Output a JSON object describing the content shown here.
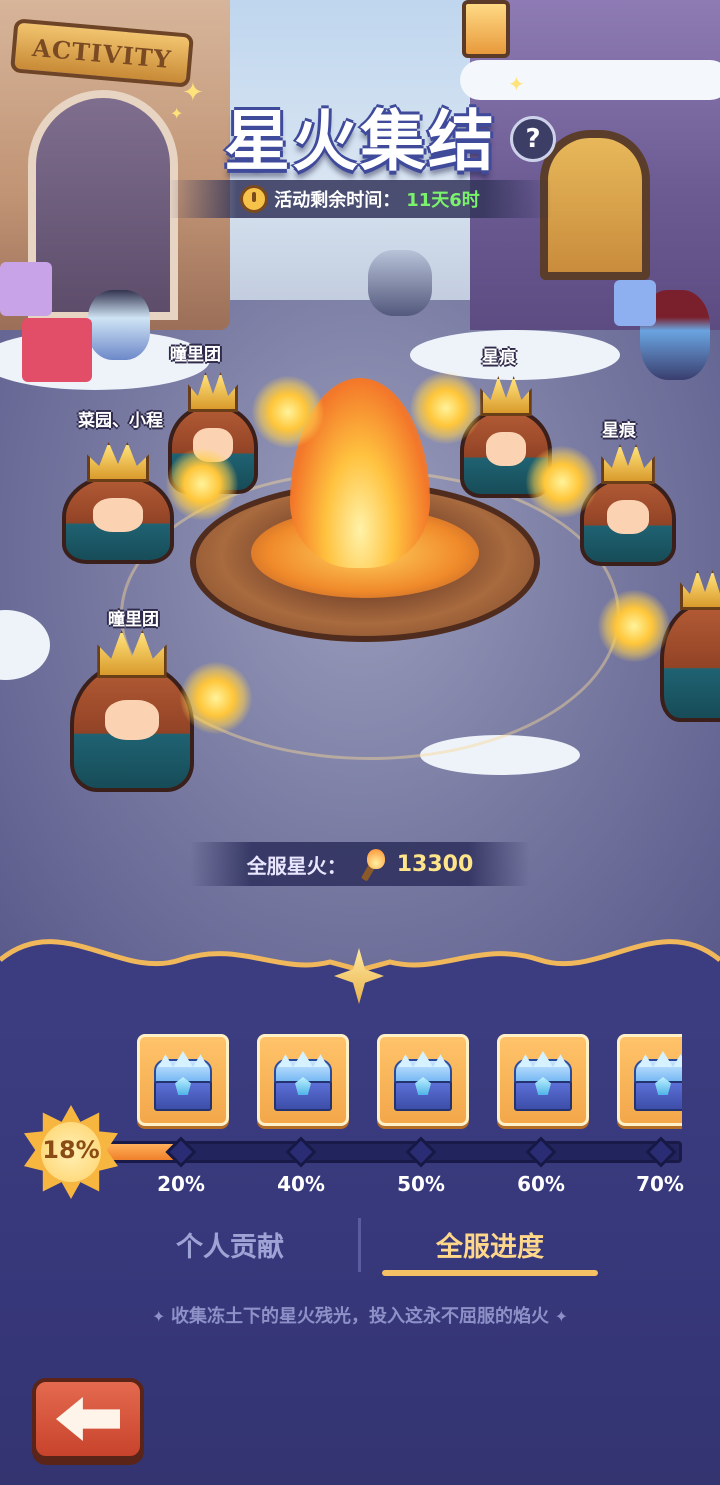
{
  "header": {
    "sign_text": "ACTIVITY",
    "title": "星火集结",
    "help_label": "?",
    "timer_label": "活动剩余时间：",
    "timer_value": "11天6时"
  },
  "players": [
    {
      "name": "曈里团"
    },
    {
      "name": "菜园、小程"
    },
    {
      "name": "星痕"
    },
    {
      "name": "星痕"
    },
    {
      "name": "曈里团"
    }
  ],
  "server_total": {
    "label": "全服星火：",
    "value": "13300",
    "icon": "torch-icon"
  },
  "progress": {
    "current_percent": 18,
    "current_label": "18%",
    "milestones": [
      {
        "label": "20%",
        "value": 20,
        "reward_icon": "ice-chest-icon"
      },
      {
        "label": "40%",
        "value": 40,
        "reward_icon": "ice-chest-icon"
      },
      {
        "label": "50%",
        "value": 50,
        "reward_icon": "ice-chest-icon"
      },
      {
        "label": "60%",
        "value": 60,
        "reward_icon": "ice-chest-icon"
      },
      {
        "label": "70%",
        "value": 70,
        "reward_icon": "ice-chest-icon"
      }
    ]
  },
  "tabs": {
    "personal": "个人贡献",
    "server": "全服进度",
    "active": "server"
  },
  "tagline": "收集冻土下的星火残光，投入这永不屈服的焰火",
  "back_button": {
    "icon": "back-arrow-icon"
  },
  "colors": {
    "accent": "#f6c064",
    "timer_value": "#7bf26b",
    "total_value": "#ffe58a",
    "panel_bg": "#3c3d80",
    "back_button": "#d65238"
  }
}
